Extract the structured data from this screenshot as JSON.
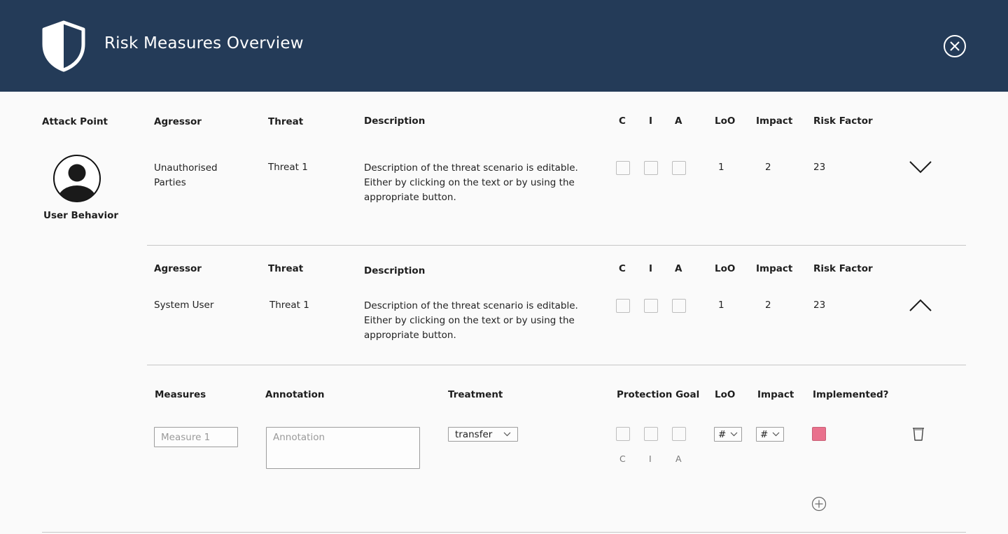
{
  "header": {
    "title": "Risk Measures Overview",
    "bg_color": "#243b58",
    "icons": [
      "shield-icon",
      "close-icon"
    ]
  },
  "attack_point": {
    "label": "Attack Point",
    "name": "User Behavior",
    "icon": "user-avatar-icon"
  },
  "threat_columns": {
    "agressor": "Agressor",
    "threat": "Threat",
    "description": "Description",
    "c": "C",
    "i": "I",
    "a": "A",
    "loo": "LoO",
    "impact": "Impact",
    "risk_factor": "Risk Factor"
  },
  "threats": [
    {
      "agressor": "Unauthorised Parties",
      "threat": "Threat 1",
      "description": "Description of the threat scenario is editable. Either by clicking on the text or by using the appropriate button.",
      "loo": "1",
      "impact": "2",
      "risk_factor": "23",
      "expanded": false
    },
    {
      "agressor": "System User",
      "threat": "Threat 1",
      "description": "Description of the threat scenario is editable. Either by clicking on the text or by using the appropriate button.",
      "loo": "1",
      "impact": "2",
      "risk_factor": "23",
      "expanded": true
    }
  ],
  "measures_columns": {
    "measures": "Measures",
    "annotation": "Annotation",
    "treatment": "Treatment",
    "protection_goal": "Protection Goal",
    "loo": "LoO",
    "impact": "Impact",
    "implemented": "Implemented?"
  },
  "measure_row": {
    "measure_placeholder": "Measure 1",
    "annotation_placeholder": "Annotation",
    "treatment_value": "transfer",
    "goal_labels": [
      "C",
      "I",
      "A"
    ],
    "loo_value": "#",
    "impact_value": "#",
    "implemented_color": "#e9718d"
  }
}
